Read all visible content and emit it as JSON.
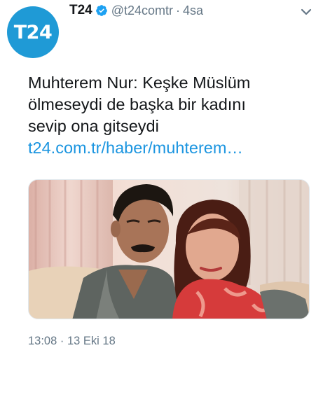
{
  "tweet": {
    "avatar_text": "T24",
    "display_name": "T24",
    "handle": "@t24comtr",
    "separator": "·",
    "relative_time": "4sa",
    "text_lines": [
      "Muhterem Nur: Keşke Müslüm",
      "ölmeseydi de başka bir kadını",
      "sevip ona gitseydi"
    ],
    "link": "t24.com.tr/haber/muhterem…",
    "timestamp": "13:08 · 13 Eki 18",
    "colors": {
      "brand": "#1f9ad6",
      "link": "#1b95e0",
      "muted": "#657786",
      "verified": "#1da1f2"
    },
    "icons": {
      "verified": "verified-badge-icon",
      "menu": "chevron-down-icon"
    }
  }
}
